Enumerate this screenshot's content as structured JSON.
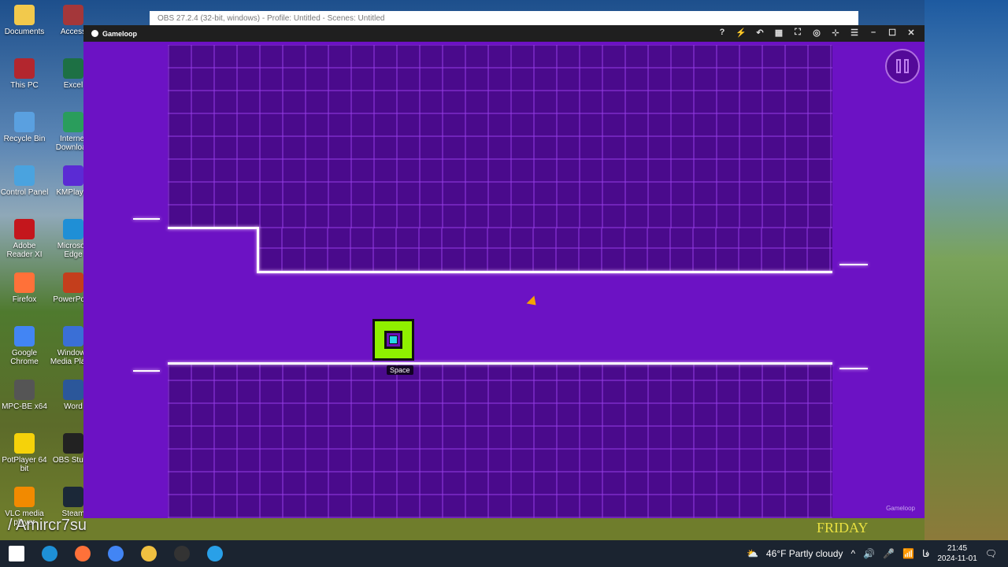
{
  "desktop": {
    "icons_col1": [
      "Documents",
      "This PC",
      "Recycle Bin",
      "Control Panel",
      "Adobe Reader XI",
      "Firefox",
      "Google Chrome",
      "MPC-BE x64",
      "PotPlayer 64 bit",
      "VLC media player"
    ],
    "icons_col2": [
      "Access",
      "Excel",
      "Internet Download",
      "KMPlayer",
      "Microsoft Edge",
      "PowerPoint",
      "Windows Media Player",
      "Word",
      "OBS Studio",
      "Steam"
    ],
    "colors": [
      "#f2c94c",
      "#b3262e",
      "#5aa0e0",
      "#4aa3df",
      "#c4161c",
      "#ff7139",
      "#4285f4",
      "#555555",
      "#f5d20a",
      "#f28a00"
    ],
    "colors2": [
      "#a4373a",
      "#1d7044",
      "#2a9d5c",
      "#5b2bd4",
      "#1f8fd6",
      "#c43e1c",
      "#3a6fd6",
      "#2b579a",
      "#222222",
      "#1b2838"
    ],
    "channel_watermark": "/ Amircr7su",
    "wallpaper_text": "FRIDAY"
  },
  "obs_window": {
    "title": "OBS 27.2.4 (32-bit, windows) - Profile: Untitled - Scenes: Untitled"
  },
  "gameloop": {
    "title": "Gameloop",
    "toolbar_icons": [
      "help-icon",
      "boost-icon",
      "back-icon",
      "keymap-icon",
      "fullscreen-icon",
      "controller-icon",
      "pin-icon",
      "menu-icon",
      "minimize-icon",
      "maximize-icon",
      "close-icon"
    ],
    "toolbar_glyphs": [
      "?",
      "⚡",
      "↶",
      "▦",
      "⛶",
      "◎",
      "⊹",
      "☰",
      "–",
      "☐",
      "✕"
    ],
    "watermark": "Gameloop",
    "game": {
      "key_hint": "Space",
      "player_color": "#8ff000",
      "player_core": "#27d8e8",
      "bg": "#6c12c4"
    }
  },
  "taskbar": {
    "weather": "46°F  Partly cloudy",
    "time": "21:45",
    "date": "2024-11-01",
    "apps": [
      "start",
      "edge",
      "firefox",
      "chrome",
      "file-explorer",
      "obs",
      "gameloop"
    ]
  }
}
